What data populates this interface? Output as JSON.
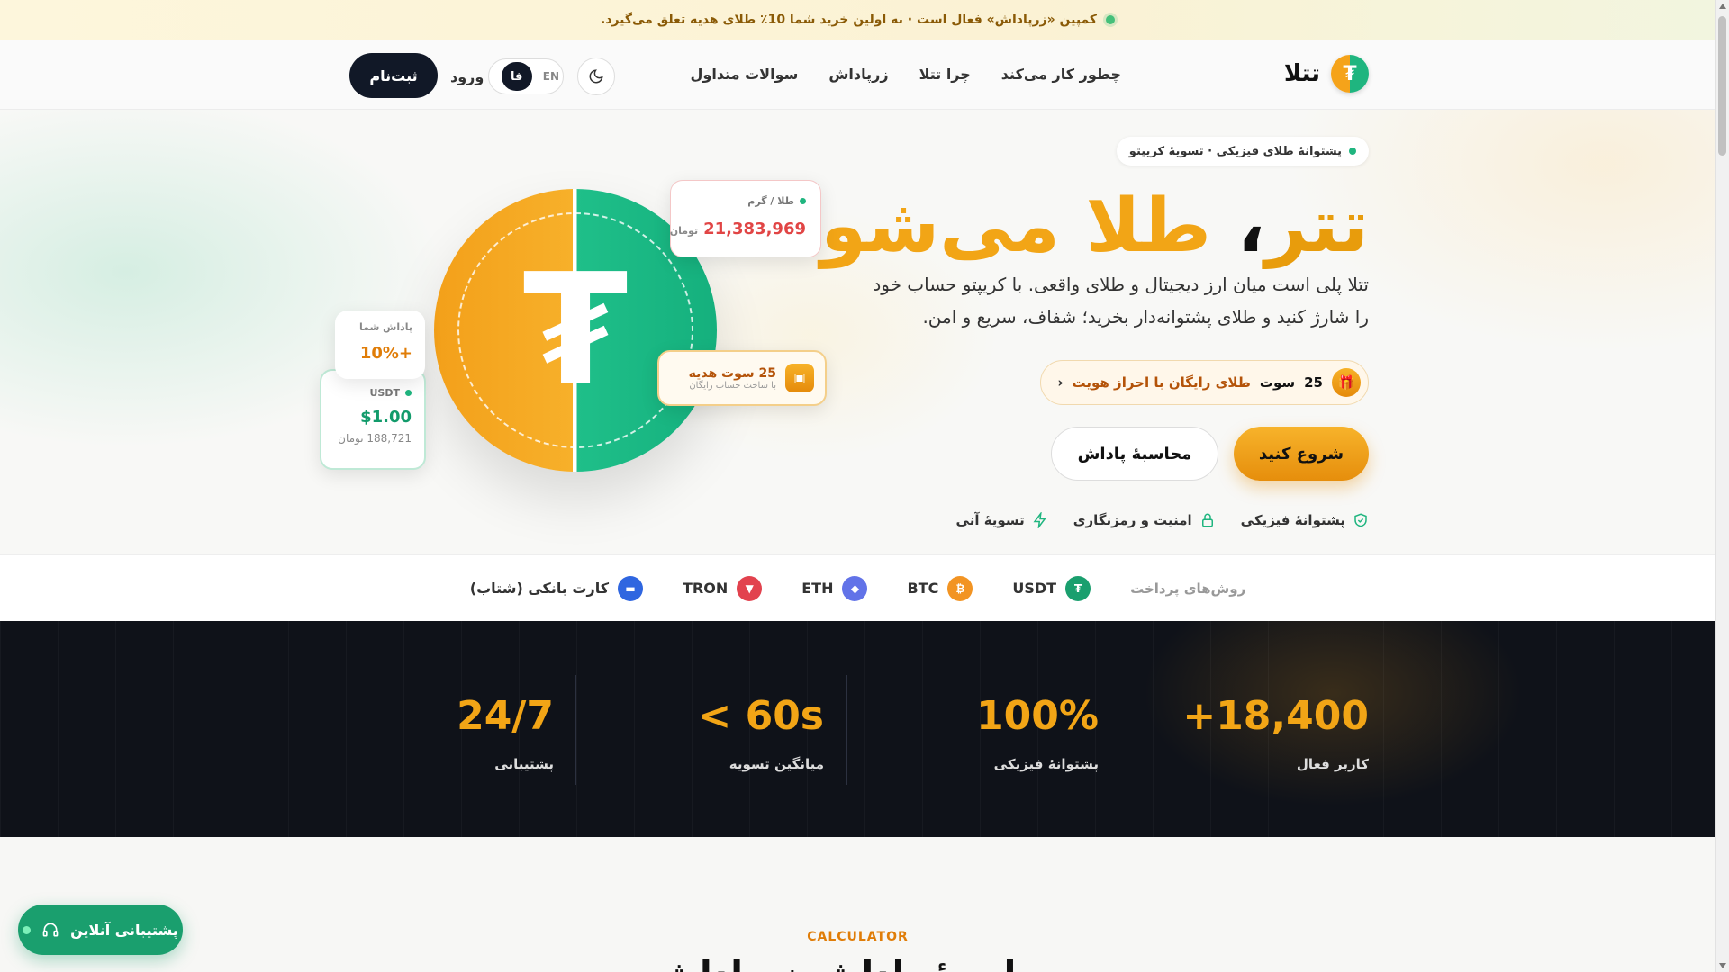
{
  "campaign": {
    "text": "کمپین «زرپاداش» فعال است · به اولین خرید شما 10٪ طلای هدیه تعلق می‌گیرد."
  },
  "header": {
    "logo_text": "تتلا",
    "logo_glyph": "₮",
    "nav": [
      "چطور کار می‌کند",
      "چرا تتلا",
      "زرپاداش",
      "سوالات متداول"
    ],
    "lang_fa": "فا",
    "lang_en": "EN",
    "login": "ورود",
    "signup": "ثبت‌نام"
  },
  "hero": {
    "pill": "پشتوانهٔ طلای فیزیکی · تسویهٔ کریپتو",
    "title_part1": "تتر",
    "title_comma": "،",
    "title_part2": "طلا می‌شود",
    "description": "تتلا پلی است میان ارز دیجیتال و طلای واقعی. با کریپتو حساب خود را شارژ کنید و طلای پشتوانه‌دار بخرید؛ شفاف، سریع و امن.",
    "gift_num": "25",
    "gift_unit": "سوت",
    "gift_text": "طلای رایگان با احراز هویت",
    "gift_chevron": "‹",
    "btn_start": "شروع کنید",
    "btn_calc": "محاسبهٔ پاداش",
    "features": [
      "پشتوانهٔ فیزیکی",
      "امنیت و رمزنگاری",
      "تسویهٔ آنی"
    ]
  },
  "cards": {
    "price_label": "طلا / گرم",
    "price_value": "21,383,969",
    "price_unit": "تومان",
    "gift_title": "25 سوت هدیه",
    "gift_sub": "با ساخت حساب رایگان",
    "reward_label": "پاداش شما",
    "reward_value": "+10%",
    "usdt_label": "USDT",
    "usdt_value": "$1.00",
    "usdt_toman": "188,721 تومان"
  },
  "payment": {
    "label": "روش‌های پرداخت",
    "methods": [
      {
        "name": "USDT",
        "glyph": "₮",
        "color": "#1a9f6e"
      },
      {
        "name": "BTC",
        "glyph": "₿",
        "color": "#f29423"
      },
      {
        "name": "ETH",
        "glyph": "◆",
        "color": "#6273e8"
      },
      {
        "name": "TRON",
        "glyph": "▼",
        "color": "#e2424e"
      },
      {
        "name": "کارت بانکی (شتاب)",
        "glyph": "▬",
        "color": "#2f66e0"
      }
    ]
  },
  "stats": [
    {
      "value": "+18,400",
      "caption": "کاربر فعال"
    },
    {
      "value": "100%",
      "caption": "پشتوانهٔ فیزیکی"
    },
    {
      "value": "< 60s",
      "caption": "میانگین تسویه"
    },
    {
      "value": "24/7",
      "caption": "پشتیبانی"
    }
  ],
  "calculator": {
    "eyebrow": "CALCULATOR",
    "title": "محاسبهٔ پاداش زرپاداش"
  },
  "support": {
    "label": "پشتیبانی آنلاین"
  },
  "colors": {
    "accent": "#f2a516",
    "brand_green": "#1fb57f",
    "dark": "#111827"
  }
}
